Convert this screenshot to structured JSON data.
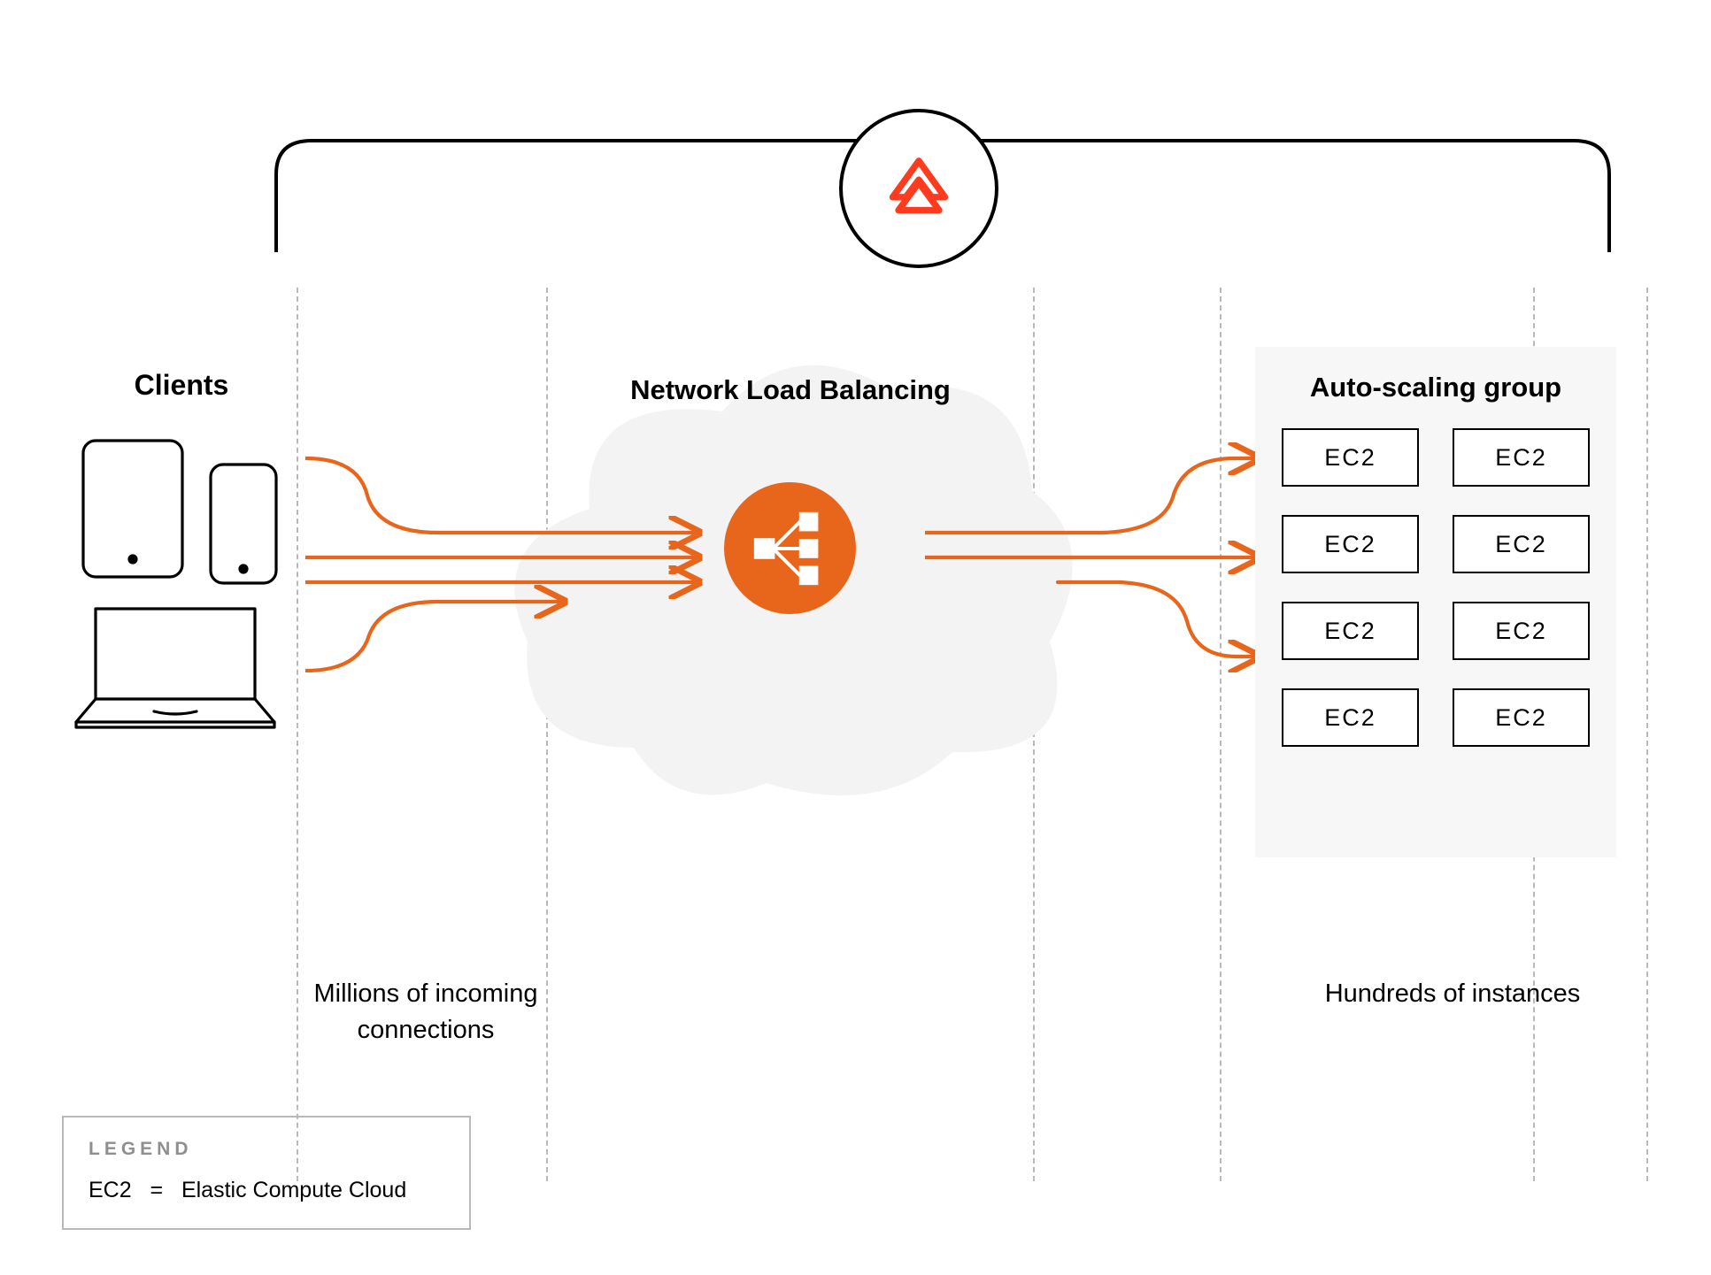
{
  "sections": {
    "clients_label": "Clients",
    "nlb_label": "Network Load Balancing",
    "asg_label": "Auto-scaling group"
  },
  "captions": {
    "incoming": "Millions of incoming connections",
    "instances": "Hundreds of instances"
  },
  "ec2_boxes": [
    "EC2",
    "EC2",
    "EC2",
    "EC2",
    "EC2",
    "EC2",
    "EC2",
    "EC2"
  ],
  "legend": {
    "title": "LEGEND",
    "abbr": "EC2",
    "eq": "=",
    "full": "Elastic Compute Cloud"
  },
  "colors": {
    "accent": "#E8661B",
    "brand_red": "#FF3B1F",
    "stroke": "#000",
    "cloud_fill": "#f3f3f3",
    "dash": "#b9b9b9"
  }
}
